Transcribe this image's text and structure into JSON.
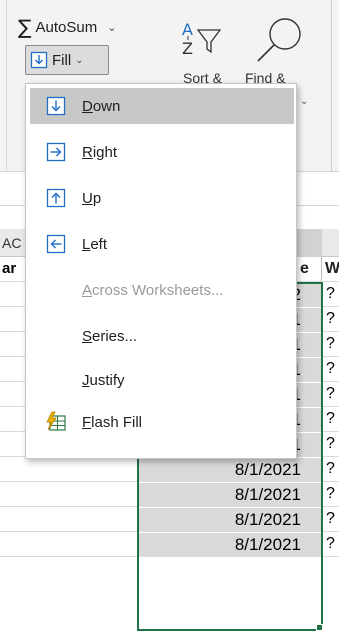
{
  "ribbon": {
    "autosum_label": "AutoSum",
    "autosum_caret": "⌄",
    "fill_label": "Fill",
    "fill_caret": "⌄",
    "sort_label": "Sort &",
    "find_label": "Find &",
    "find_caret": "⌄"
  },
  "menu": {
    "items": [
      {
        "label": "Down",
        "mnemonic": "D",
        "rest": "own",
        "icon": "fill-down-icon"
      },
      {
        "label": "Right",
        "mnemonic": "R",
        "rest": "ight",
        "icon": "fill-right-icon"
      },
      {
        "label": "Up",
        "mnemonic": "U",
        "rest": "p",
        "icon": "fill-up-icon"
      },
      {
        "label": "Left",
        "mnemonic": "L",
        "rest": "eft",
        "icon": "fill-left-icon"
      },
      {
        "label": "Across Worksheets...",
        "mnemonic": "A",
        "rest": "cross Worksheets...",
        "icon": ""
      },
      {
        "label": "Series...",
        "mnemonic": "S",
        "rest": "eries...",
        "icon": ""
      },
      {
        "label": "Justify",
        "mnemonic": "J",
        "rest": "ustify",
        "icon": ""
      },
      {
        "label": "Flash Fill",
        "mnemonic": "F",
        "rest": "lash Fill",
        "icon": "flash-fill-icon"
      }
    ]
  },
  "sheet": {
    "column_header_text": "AC",
    "header_row": {
      "left_text": "ar",
      "date_header_tail": "e",
      "next_col_header": "W"
    },
    "partial_rows": [
      {
        "tail": "22",
        "q": "?"
      },
      {
        "tail": "21",
        "q": "?"
      },
      {
        "tail": "21",
        "q": "?"
      },
      {
        "tail": "21",
        "q": "?"
      },
      {
        "tail": "21",
        "q": "?"
      }
    ],
    "rows": [
      {
        "date": "8/1/2021",
        "q": "?"
      },
      {
        "date": "8/1/2021",
        "q": "?"
      },
      {
        "date": "8/1/2021",
        "q": "?"
      },
      {
        "date": "8/1/2021",
        "q": "?"
      },
      {
        "date": "8/1/2021",
        "q": "?"
      },
      {
        "date": "8/1/2021",
        "q": "?"
      }
    ]
  },
  "colors": {
    "accent": "#217346",
    "icon_blue": "#1f6fc5",
    "menu_highlight": "#c8c8c8",
    "selection_fill": "#d9d9d9"
  }
}
